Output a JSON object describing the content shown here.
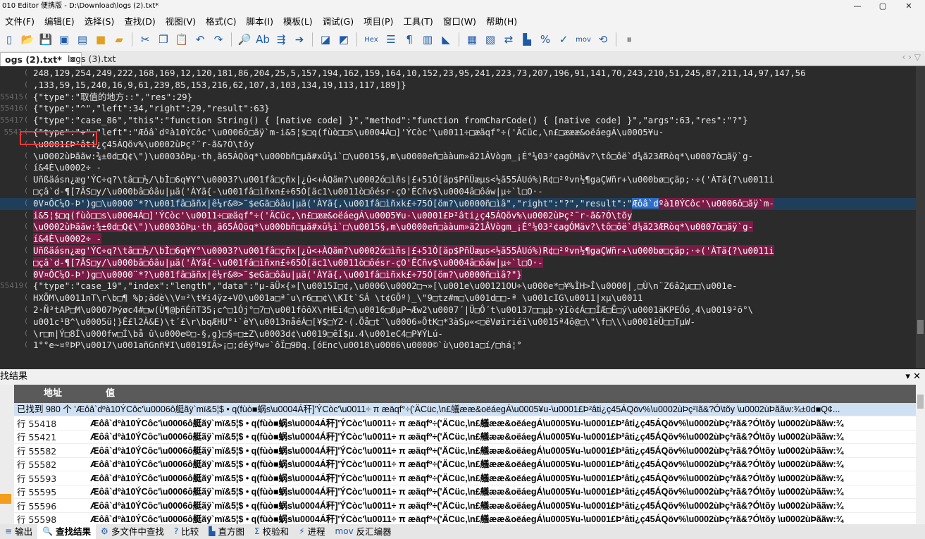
{
  "window": {
    "title": "010 Editor 便携版 - D:\\Download\\logs (2).txt*",
    "minimize": "—",
    "restore": "▢",
    "close": "✕"
  },
  "menu": [
    "文件(F)",
    "编辑(E)",
    "选择(S)",
    "查找(D)",
    "视图(V)",
    "格式(C)",
    "脚本(I)",
    "模板(L)",
    "调试(G)",
    "项目(P)",
    "工具(T)",
    "窗口(W)",
    "帮助(H)"
  ],
  "toolbar": {
    "hex_label": "Hex",
    "mov_label": "mov"
  },
  "tabs": [
    {
      "label": "ogs (2).txt*",
      "close": "✕"
    },
    {
      "label": "logs (3).txt"
    }
  ],
  "tab_nav": "‹  ›  ▽",
  "editor": {
    "lines": [
      {
        "ln": "",
        "text": "248,129,254,249,222,168,169,12,120,181,86,204,25,5,157,194,162,159,164,10,152,23,95,241,223,73,207,196,91,141,70,243,210,51,245,87,211,14,97,147,56"
      },
      {
        "ln": "",
        "text": ",133,59,15,240,16,9,61,239,85,153,216,62,107,3,103,134,19,113,117,189]}"
      },
      {
        "ln": "55415",
        "text": "{\"type\":\"取值的地方::\",\"res\":29}"
      },
      {
        "ln": "55416",
        "text": "{\"type\":\"^\",\"left\":34,\"right\":29,\"result\":63}"
      },
      {
        "ln": "55417",
        "text": "{\"type\":\"case_86\",\"this\":\"function String() { [native code] }\",\"method\":\"function fromCharCode() { [native code] }\",\"args\":63,\"res\":\"?\"}"
      },
      {
        "ln": "5541",
        "text": "{\"type\":\"+\",\"left\":\"Æôâ`dºà10ÝCôc'\\u0006ô□ãÿ`m-i&5¦$□q(fùò□□s\\u0004Á□]'ÝCòc'\\u0011÷□æäqf°÷('ÄCüc,\\n£□æææ&oëáegÁ\\u0005¥u-"
      },
      {
        "ln": "",
        "text": "\\u0001£Þ²âti¿ç45ÁQöv%\\u0002ùÞç²¨r-ã&?Ó\\tõy"
      },
      {
        "ln": "",
        "text": "\\u0002ùÞããw:¾±0d□Q¢\\\")\\u0003ôÞµ·th¸ã65ÁQöq*\\u000bñ□µã#xû¼i`□\\u0015§,m\\u0000eñ□ààum»ã21ÂVògm_¡É°¼03²¢agÓMäv?\\tô□ôë`d¼ã23ÆRòq*\\u0007ò□ãÿ`g-"
      },
      {
        "ln": "",
        "text": "í&4È\\u0002÷ -"
      },
      {
        "ln": "",
        "text": "Uñßäásn¿æg'ÝC÷q?\\tâ□□½/\\bÌ□6q¥Y°\\u0003?\\u001fâ□çñx|¿û<+ÀQäm?\\u0002ó□ìñs|£+51Ó[äp$PñÜæµs<½ã55ÁUó%)R¢□²ºvn½¶gaÇWñr+\\u000bø□çäp;·÷('ÀTä{?\\u0011i"
      },
      {
        "ln": "",
        "text": "□çâ`d-¶[7ÃS□y/\\u000bâ□ôâu|µä('ÀYä{-\\u001fâ□ìñxn£÷65Ó[äc1\\u0011ò□ôésr-çO'ËCñv$\\u0004â□ôáw|µ÷`l□O·-"
      },
      {
        "ln": "",
        "pre": "0V¤ÔC¼O-Þ')g□\\u0000¨*?\\u001fâ□ãñx|ê¼r&®>¨$eGã□ôâu|µä('ÀYä{,\\u001fâ□ìñxk£÷75Ó[öm?\\u0000ñ□ìâ\",\"right\":\"?\",\"result\":\"",
        "sel": "Æôâ`d",
        "post": "ºà10ÝCôc'\\u0006ô□ãÿ`m-"
      },
      {
        "ln": "",
        "text": "i&5¦$□q(fùò□□s\\u0004Á□]'ÝCòc'\\u0011÷□æäqf°÷('ÄCüc,\\n£□ææ&oëáegÁ\\u0005¥u-\\u0001£Þ²âti¿ç45ÁQöv%\\u0002ùÞç²¨r-ã&?Ó\\tõy"
      },
      {
        "ln": "",
        "text": "\\u0002ùÞããw:¾±0d□Q¢\\\")\\u0003ôÞµ·th¸ã65ÁQöq*\\u000bñ□µã#xû¼i`□\\u0015§,m\\u0000eñ□ààum»ã21ÂVògm_¡É°¼03²¢agÓMäv?\\tô□ôë`d¼ã23ÆRòq*\\u0007ò□ãÿ`g-"
      },
      {
        "ln": "",
        "text": "í&4È\\u0002÷ -"
      },
      {
        "ln": "",
        "text": "Uñßäásn¿æg'ÝC÷q?\\tâ□□½/\\bÌ□6q¥Y°\\u0003?\\u001fâ□çñx|¿û<+ÀQäm?\\u0002ó□ìñs|£+51Ó[äp$PñÜæµs<½ã55ÁUó%)R¢□²ºvn½¶gaÇWñr+\\u000bø□çäp;·÷('ÀTä{?\\u0011i"
      },
      {
        "ln": "",
        "text": "□çâ`d-¶[7ÃS□y/\\u000bâ□ôâu|µä('ÀYä{-\\u001fâ□ìñxn£÷65Ó[äc1\\u0011ò□ôésr-çO'ËCñv$\\u0004â□ôáw|µ÷`l□O·-"
      },
      {
        "ln": "",
        "text": "0V¤ÔC¼O-Þ')g□\\u0000¨*?\\u001fâ□ãñx|ê¼r&®>¨$eGã□ôâu|µä('ÀYä{,\\u001fâ□ìñxk£÷75Ó[öm?\\u0000ñ□ìâ?\"}"
      },
      {
        "ln": "55419",
        "text": "{\"type\":\"case_19\",\"index\":\"length\",\"data\":\"µ-ãÜ×{»[\\u0015I□¢,\\u0006\\u0002□¬»[\\u001e\\u00121OU÷\\u000e*□¥%ÌH>Î\\u0000|¸□Ù\\n¨Z6â2µ□□\\u001e-"
      },
      {
        "ln": "",
        "text": "HXÕM\\u0011nT\\r\\b□¶ %þ;âdè\\\\V¤²\\t¥i4ÿz+VO\\u001a□ª¯u\\r6□□¢\\\\KIt`SÁ \\t¢GÕº)_\\\"9□tz#m□\\u001d□□-ª \\u001cIG\\u0011|xµ\\u0011"
      },
      {
        "ln": "",
        "text": "2·Ñ³tAP□M\\u0007Þýøc4#□w(Ù¶@þñÉñT35¡c^□1Ój°□7□\\u001fôôX\\rHEi4□\\u0016□ØµP¬Æw2\\u0007´|Ü□Ô´t\\u00137□□µþ·ýIò¢Á□□ÎÆ□Ë□ý\\u0001äKPEÓó¸4\\u0019²ö°\\"
      },
      {
        "ln": "",
        "text": "u001c¹B^\\u0005ü¦}Ê£l2À&E)\\t´£\\r\\bqÆHU°¹`èY\\u0013nåéÁ□[¥$□YZ·(.Õå□t¨\\u0006»ÕtK□*3àSµ«<□ëVøïriéï\\u0015ª4ô@□\\\"\\f□\\\\\\u0001èÜ□□TµW-"
      },
      {
        "ln": "",
        "text": "\\r□m|Ý□8Í\\u000fw□Í\\bå û\\u000e©□-§,g}□§=□±Z\\u0003d¢\\u0019□êÍ$µ.4\\u001eC4□P¥ÝLú-"
      },
      {
        "ln": "",
        "text": "1°°e~¤ºÞP\\u0017\\u001añGnñ¥I\\u0019IÂ>¡□;dêýºw¤`ôÏ□9Ðq.[óEnc\\u0018\\u0006\\u0000©`ù\\u001a□í/□há¦°"
      }
    ]
  },
  "find_results": {
    "title": "找结果",
    "close": "✕",
    "col_addr": "地址",
    "col_value": "值",
    "summary": "已找到 980 个 'Æôâ`dºà10ÝCôc'\\u0006ô艇ãÿ`mï&5¦$ • q(fùò■蜗s\\u0004Á秆]'ÝCòc'\\u0011÷ π æäqf°÷('ÄCüc,\\n£艤ææ&oëáegÁ\\u0005¥u-\\u0001£Þ²âti¿ç45ÁQöv%\\u0002ùÞç²ïã&?Ó\\tõy \\u0002ùÞããw:¾±0d■Q¢...",
    "rows": [
      {
        "addr": "行 55418",
        "value": "Æôâ`dºà10ÝCôc'\\u0006ô艇ãÿ`mï&5¦$ • q(fùò■蜗s\\u0004Á秆]'ÝCòc'\\u0011÷ π æäqfº÷('ÄCüc,\\n£艤ææ&oëáegÁ\\u0005¥u-\\u0001£Þ²âti¿ç45ÁQöv%\\u0002ùÞç²rã&?Ó\\tõy \\u0002ùÞããw:¾"
      },
      {
        "addr": "行 55421",
        "value": "Æôâ`dºà10ÝCôc'\\u0006ô艇ãÿ`mï&5¦$ • q(fùò■蜗s\\u0004Á秆]'ÝCòc'\\u0011÷ π æäqfº÷('ÄCüc,\\n£艤ææ&oëáegÁ\\u0005¥u-\\u0001£Þ²âti¿ç45ÁQöv%\\u0002ùÞç²rã&?Ó\\tõy \\u0002ùÞããw:¾"
      },
      {
        "addr": "行 55582",
        "value": "Æôâ`dºà10ÝCôc'\\u0006ô艇ãÿ`mï&5¦$ • q(fùò■蜗s\\u0004Á秆]'ÝCòc'\\u0011÷ π æäqfº÷('ÄCüc,\\n£艤ææ&oëáegÁ\\u0005¥u-\\u0001£Þ²âti¿ç45ÁQöv%\\u0002ùÞç²rã&?Ó\\tõy \\u0002ùÞããw:¾"
      },
      {
        "addr": "行 55582",
        "value": "Æôâ`dºà10ÝCôc'\\u0006ô艇ãÿ`mï&5¦$ • q(fùò■蜗s\\u0004Á秆]'ÝCòc'\\u0011÷ π æäqfº÷('ÄCüc,\\n£艤ææ&oëáegÁ\\u0005¥u-\\u0001£Þ²âti¿ç45ÁQöv%\\u0002ùÞç²rã&?Ó\\tõy \\u0002ùÞããw:¾"
      },
      {
        "addr": "行 55593",
        "value": "Æôâ`dºà10ÝCôc'\\u0006ô艇ãÿ`mï&5¦$ • q(fùò■蜗s\\u0004Á秆]'ÝCòc'\\u0011÷ π æäqfº÷('ÄCüc,\\n£艤ææ&oëáegÁ\\u0005¥u-\\u0001£Þ²âti¿ç45ÁQöv%\\u0002ùÞç²rã&?Ó\\tõy \\u0002ùÞããw:¾"
      },
      {
        "addr": "行 55595",
        "value": "Æôâ`dºà10ÝCôc'\\u0006ô艇ãÿ`mï&5¦$ • q(fùò■蜗s\\u0004Á秆]'ÝCòc'\\u0011÷ π æäqfº÷('ÄCüc,\\n£艤ææ&oëáegÁ\\u0005¥u-\\u0001£Þ²âti¿ç45ÁQöv%\\u0002ùÞç²rã&?Ó\\tõy \\u0002ùÞããw:¾"
      },
      {
        "addr": "行 55596",
        "value": "Æôâ`dºà10ÝCôc'\\u0006ô艇ãÿ`mï&5¦$ • q(fùò■蜗s\\u0004Á秆]'ÝCòc'\\u0011÷ π æäqfº÷('ÄCüc,\\n£艤ææ&oëáegÁ\\u0005¥u-\\u0001£Þ²âti¿ç45ÁQöv%\\u0002ùÞç²rã&?Ó\\tõy \\u0002ùÞããw:¾"
      },
      {
        "addr": "行 55598",
        "value": "Æôâ`dºà10ÝCôc'\\u0006ô艇ãÿ`mï&5¦$ • q(fùò■蜗s\\u0004Á秆]'ÝCòc'\\u0011÷ π æäqfº÷('ÄCüc,\\n£艤ææ&oëáegÁ\\u0005¥u-\\u0001£Þ²âti¿ç45ÁQöv%\\u0002ùÞç²rã&?Ó\\tõy \\u0002ùÞããw:¾"
      }
    ]
  },
  "statusbar": [
    {
      "label": "输出",
      "icon": "output-icon",
      "glyph": "≡"
    },
    {
      "label": "查找结果",
      "icon": "find-results-icon",
      "glyph": "🔍",
      "active": true
    },
    {
      "label": "多文件中查找",
      "icon": "find-in-files-icon",
      "glyph": "⚙"
    },
    {
      "label": "比较",
      "icon": "compare-icon",
      "glyph": "?"
    },
    {
      "label": "直方图",
      "icon": "histogram-icon",
      "glyph": "▙"
    },
    {
      "label": "校验和",
      "icon": "checksum-icon",
      "glyph": "Σ"
    },
    {
      "label": "进程",
      "icon": "process-icon",
      "glyph": "⚡"
    },
    {
      "label": "反汇编器",
      "icon": "disassembler-icon",
      "glyph": "mov"
    }
  ],
  "colors": {
    "editor_bg": "#2b2b2b",
    "highlight": "#7b1b45",
    "selection": "#2d6ec9",
    "red_box": "#e53a3a",
    "find_summary_bg": "#cfe0f3"
  }
}
